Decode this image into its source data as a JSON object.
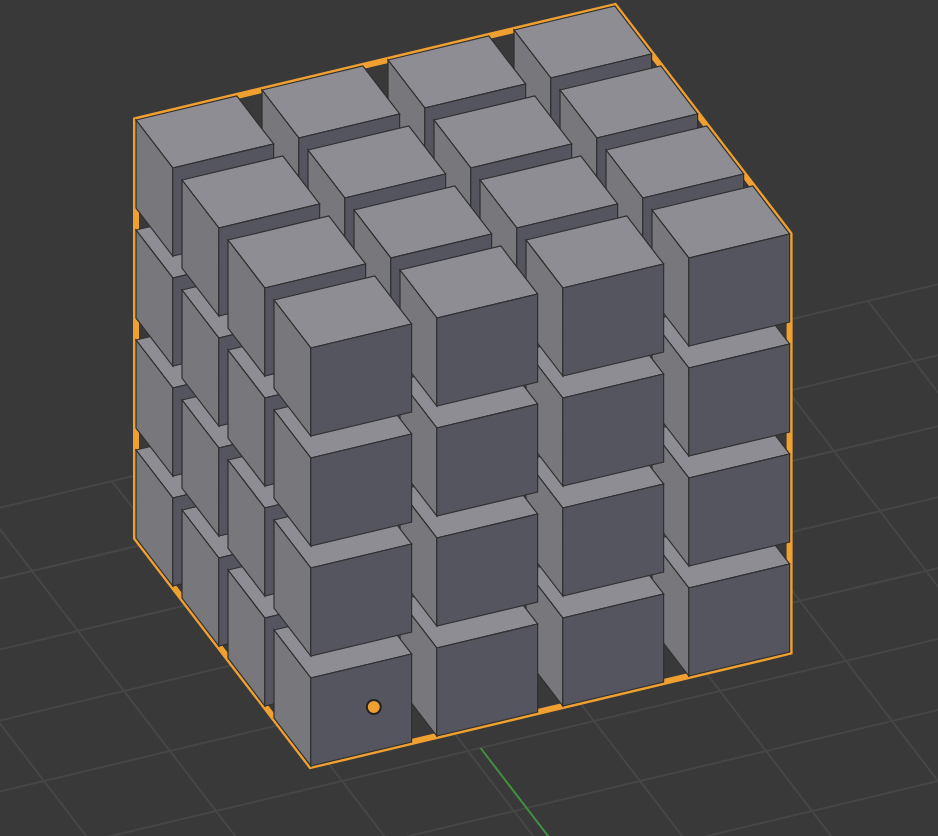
{
  "viewport": {
    "object": {
      "selected": true,
      "show_origin": true
    }
  }
}
